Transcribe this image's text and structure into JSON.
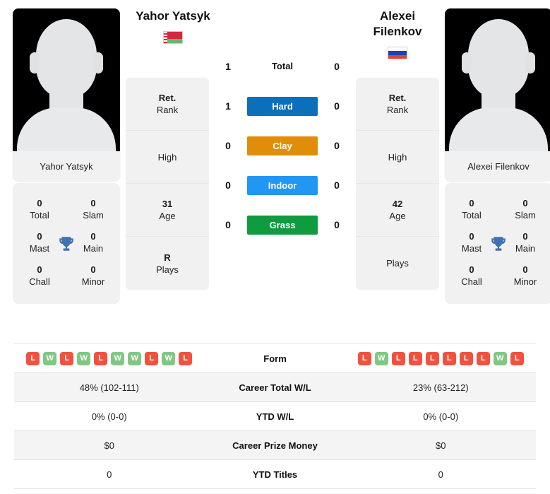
{
  "players": {
    "left": {
      "name": "Yahor Yatsyk",
      "photo_caption": "Yahor Yatsyk",
      "flag": "belarus-flag",
      "titles": [
        {
          "value": "0",
          "label": "Total"
        },
        {
          "value": "0",
          "label": "Slam"
        },
        {
          "value": "0",
          "label": "Mast"
        },
        {
          "value": "0",
          "label": "Main"
        },
        {
          "value": "0",
          "label": "Chall"
        },
        {
          "value": "0",
          "label": "Minor"
        }
      ],
      "info": [
        {
          "value": "Ret.",
          "label": "Rank"
        },
        {
          "value": "",
          "label": "High"
        },
        {
          "value": "31",
          "label": "Age"
        },
        {
          "value": "R",
          "label": "Plays"
        }
      ],
      "form": [
        "L",
        "W",
        "L",
        "W",
        "L",
        "W",
        "W",
        "L",
        "W",
        "L"
      ],
      "stats": {
        "career_wl": "48% (102-111)",
        "ytd_wl": "0% (0-0)",
        "prize_money": "$0",
        "ytd_titles": "0"
      },
      "surface_scores": {
        "total": "1",
        "hard": "1",
        "clay": "0",
        "indoor": "0",
        "grass": "0"
      }
    },
    "right": {
      "name": "Alexei Filenkov",
      "name_line1": "Alexei",
      "name_line2": "Filenkov",
      "photo_caption": "Alexei Filenkov",
      "flag": "russia-flag",
      "titles": [
        {
          "value": "0",
          "label": "Total"
        },
        {
          "value": "0",
          "label": "Slam"
        },
        {
          "value": "0",
          "label": "Mast"
        },
        {
          "value": "0",
          "label": "Main"
        },
        {
          "value": "0",
          "label": "Chall"
        },
        {
          "value": "0",
          "label": "Minor"
        }
      ],
      "info": [
        {
          "value": "Ret.",
          "label": "Rank"
        },
        {
          "value": "",
          "label": "High"
        },
        {
          "value": "42",
          "label": "Age"
        },
        {
          "value": "",
          "label": "Plays"
        }
      ],
      "form": [
        "L",
        "W",
        "L",
        "L",
        "L",
        "L",
        "L",
        "L",
        "W",
        "L"
      ],
      "stats": {
        "career_wl": "23% (63-212)",
        "ytd_wl": "0% (0-0)",
        "prize_money": "$0",
        "ytd_titles": "0"
      },
      "surface_scores": {
        "total": "0",
        "hard": "0",
        "clay": "0",
        "indoor": "0",
        "grass": "0"
      }
    }
  },
  "surfaces": [
    {
      "key": "total",
      "label": "Total",
      "color": "",
      "is_bar": false
    },
    {
      "key": "hard",
      "label": "Hard",
      "color": "#0b6fba",
      "is_bar": true
    },
    {
      "key": "clay",
      "label": "Clay",
      "color": "#e08e09",
      "is_bar": true
    },
    {
      "key": "indoor",
      "label": "Indoor",
      "color": "#2196f3",
      "is_bar": true
    },
    {
      "key": "grass",
      "label": "Grass",
      "color": "#0f9b3f",
      "is_bar": true
    }
  ],
  "table_rows": [
    {
      "label": "Form",
      "type": "form"
    },
    {
      "label": "Career Total W/L",
      "type": "text",
      "key": "career_wl"
    },
    {
      "label": "YTD W/L",
      "type": "text",
      "key": "ytd_wl"
    },
    {
      "label": "Career Prize Money",
      "type": "text",
      "key": "prize_money"
    },
    {
      "label": "YTD Titles",
      "type": "text",
      "key": "ytd_titles"
    }
  ],
  "colors": {
    "win_badge": "#81c784",
    "loss_badge": "#ef5340",
    "hard": "#0b6fba",
    "clay": "#e08e09",
    "indoor": "#2196f3",
    "grass": "#0f9b3f",
    "trophy": "#3f72b5",
    "card_bg": "#f1f1f1",
    "row_alt_bg": "#f4f4f4"
  },
  "icons": {
    "trophy": "trophy-icon"
  }
}
